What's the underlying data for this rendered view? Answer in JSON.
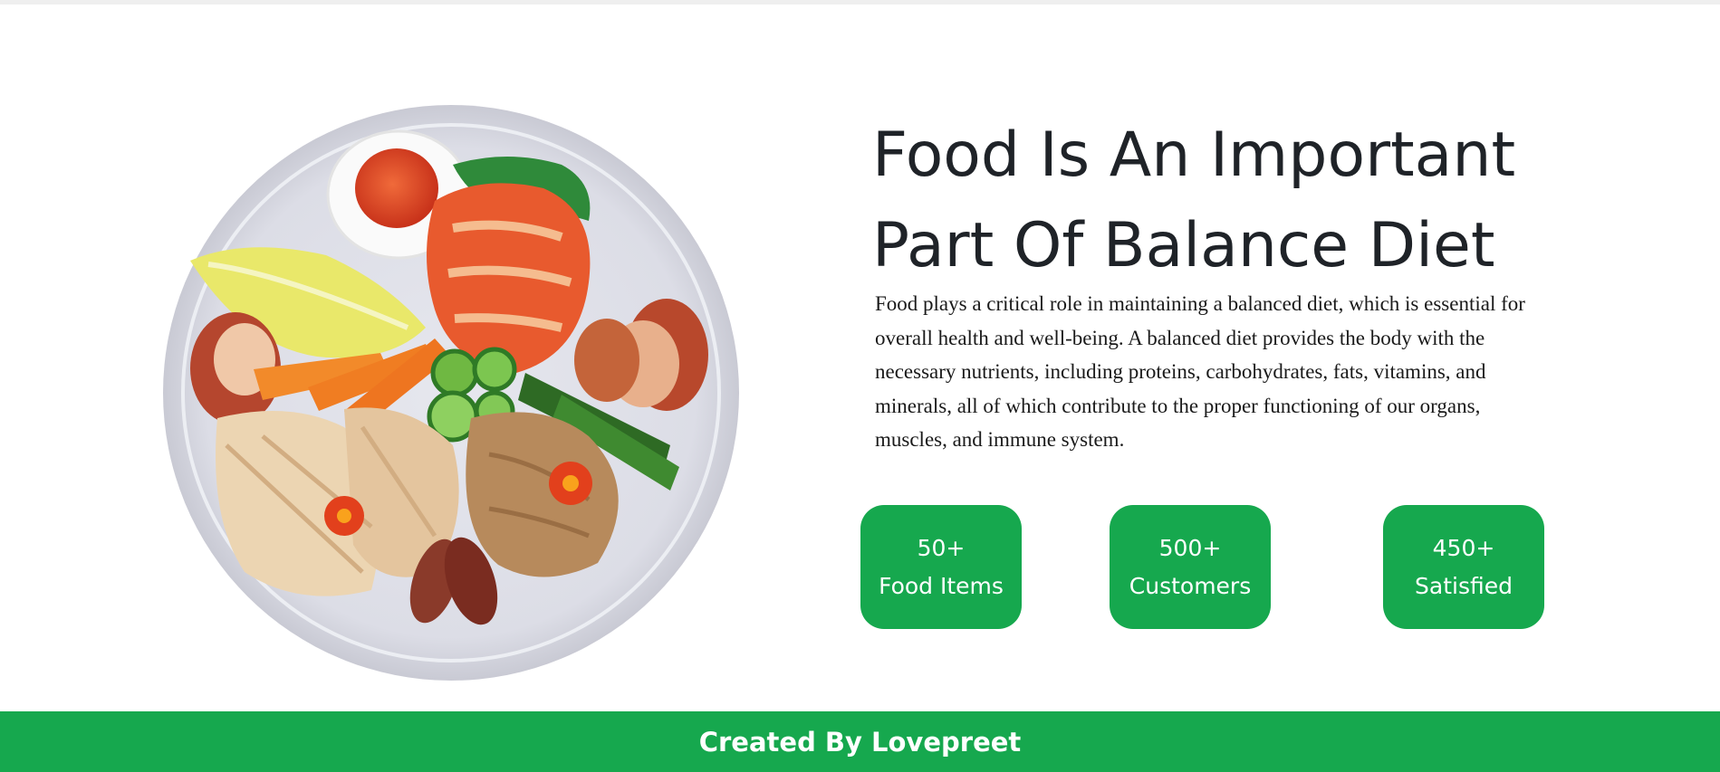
{
  "hero": {
    "heading_line1": "Food Is An Important",
    "heading_line2": "Part Of Balance Diet",
    "description": "Food plays a critical role in maintaining a balanced diet, which is essential for overall health and well-being. A balanced diet provides the body with the necessary nutrients, including proteins, carbohydrates, fats, vitamins, and minerals, all of which contribute to the proper functioning of our organs, muscles, and immune system."
  },
  "stats": [
    {
      "value": "50+",
      "label": "Food Items"
    },
    {
      "value": "500+",
      "label": "Customers"
    },
    {
      "value": "450+",
      "label": "Satisfied"
    }
  ],
  "footer": {
    "text": "Created By Lovepreet"
  },
  "colors": {
    "accent": "#16a84e",
    "heading": "#1f2328",
    "body_text": "#1a1a1a",
    "plate": "#dcdde6"
  },
  "image": {
    "icon": "food-plate-image"
  }
}
